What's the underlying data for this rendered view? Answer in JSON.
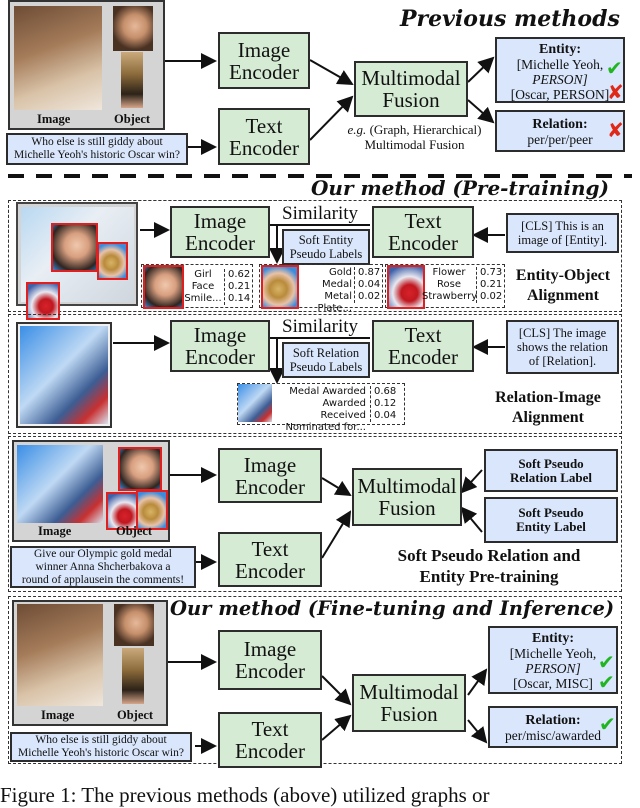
{
  "previous": {
    "title": "Previous methods",
    "image_caption": "Image",
    "object_caption": "Object",
    "text_input": [
      "Who else is still giddy about",
      "Michelle Yeoh's historic Oscar win?"
    ],
    "image_encoder": [
      "Image",
      "Encoder"
    ],
    "text_encoder": [
      "Text",
      "Encoder"
    ],
    "fusion": [
      "Multimodal",
      "Fusion"
    ],
    "fusion_note_prefix": "e.g.",
    "fusion_note": [
      "(Graph, Hierarchical)",
      "Multimodal Fusion"
    ],
    "entity_title": "Entity:",
    "entity_lines": [
      "[Michelle Yeoh,",
      "PERSON]",
      "[Oscar, PERSON]"
    ],
    "relation_title": "Relation:",
    "relation_value": "per/per/peer",
    "marks": {
      "entity1": "✔",
      "entity2": "✘",
      "relation": "✘"
    }
  },
  "pretraining": {
    "title": "Our method (Pre-training)",
    "entity_object": {
      "image_encoder": [
        "Image",
        "Encoder"
      ],
      "text_encoder": [
        "Text",
        "Encoder"
      ],
      "similarity": "Similarity",
      "soft_labels": [
        "Soft Entity",
        "Pseudo Labels"
      ],
      "prompt": [
        "[CLS] This is an",
        "image of [Entity]."
      ],
      "section_label": [
        "Entity-Object",
        "Alignment"
      ],
      "candidates": [
        {
          "labels": [
            "Girl",
            "Face",
            "Smile..."
          ],
          "scores": [
            "0.62",
            "0.21",
            "0.14"
          ]
        },
        {
          "labels": [
            "Gold Medal",
            "Metal",
            "Plate..."
          ],
          "scores": [
            "0.87",
            "0.04",
            "0.02"
          ]
        },
        {
          "labels": [
            "Flower",
            "Rose",
            "Strawberry"
          ],
          "scores": [
            "0.73",
            "0.21",
            "0.02"
          ]
        }
      ]
    },
    "relation_image": {
      "image_encoder": [
        "Image",
        "Encoder"
      ],
      "text_encoder": [
        "Text",
        "Encoder"
      ],
      "similarity": "Similarity",
      "soft_labels": [
        "Soft Relation",
        "Pseudo Labels"
      ],
      "prompt": [
        "[CLS] The image",
        "shows the relation",
        "of [Relation]."
      ],
      "section_label": [
        "Relation-Image",
        "Alignment"
      ],
      "candidates": {
        "labels": [
          "Medal Awarded",
          "Awarded Received",
          "Nominated for..."
        ],
        "scores": [
          "0.68",
          "0.12",
          "0.04"
        ]
      }
    },
    "soft_pseudo": {
      "image_caption": "Image",
      "object_caption": "Object",
      "text_input": [
        "Give our Olympic gold medal",
        "winner Anna Shcherbakova a",
        "round of applausein the comments!"
      ],
      "image_encoder": [
        "Image",
        "Encoder"
      ],
      "text_encoder": [
        "Text",
        "Encoder"
      ],
      "fusion": [
        "Multimodal",
        "Fusion"
      ],
      "relation_label": [
        "Soft Pseudo",
        "Relation Label"
      ],
      "entity_label": [
        "Soft Pseudo",
        "Entity Label"
      ],
      "section_label": [
        "Soft Pseudo Relation and",
        "Entity Pre-training"
      ]
    }
  },
  "finetuning": {
    "title": "Our method (Fine-tuning and Inference)",
    "image_caption": "Image",
    "object_caption": "Object",
    "text_input": [
      "Who else is still giddy about",
      "Michelle Yeoh's historic Oscar win?"
    ],
    "image_encoder": [
      "Image",
      "Encoder"
    ],
    "text_encoder": [
      "Text",
      "Encoder"
    ],
    "fusion": [
      "Multimodal",
      "Fusion"
    ],
    "entity_title": "Entity:",
    "entity_lines": [
      "[Michelle Yeoh,",
      "PERSON]",
      "[Oscar, MISC]"
    ],
    "relation_title": "Relation:",
    "relation_value": "per/misc/awarded",
    "marks": {
      "entity1": "✔",
      "entity2": "✔",
      "relation": "✔"
    }
  },
  "caption": "Figure 1: The previous methods (above) utilized graphs or",
  "colors": {
    "encoder": "#d5ebd4",
    "label_box": "#d9e6fb",
    "check": "#22b522",
    "cross": "#e02818",
    "object_box": "#e02020"
  }
}
